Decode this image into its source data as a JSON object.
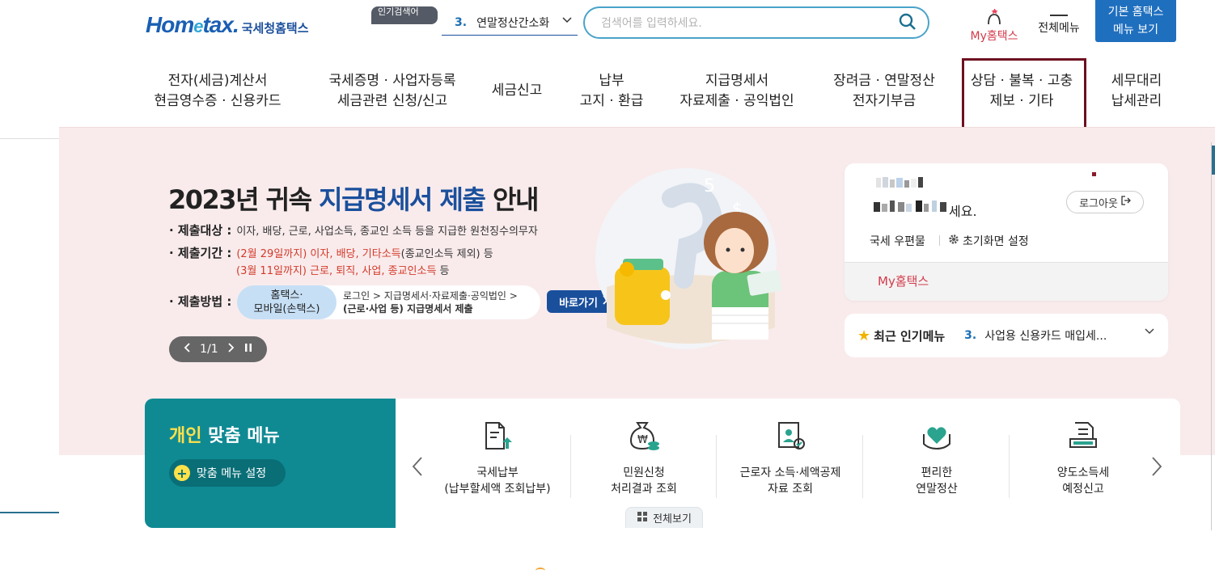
{
  "header": {
    "logo_word": "Hometax.",
    "logo_kr": "국세청홈택스",
    "logo_small": "국세청 홈택스",
    "tag_pill": "인기검색어",
    "rank_select": {
      "num": "3.",
      "value": "연말정산간소화"
    },
    "search_placeholder": "검색어를 입력하세요.",
    "my_hometax": "My홈택스",
    "full_menu": "전체메뉴",
    "basic_menu": [
      "기본 홈택스",
      "메뉴 보기"
    ]
  },
  "nav": [
    [
      "전자(세금)계산서",
      "현금영수증 · 신용카드"
    ],
    [
      "국세증명 · 사업자등록",
      "세금관련 신청/신고"
    ],
    [
      "세금신고"
    ],
    [
      "납부",
      "고지 · 환급"
    ],
    [
      "지급명세서",
      "자료제출 · 공익법인"
    ],
    [
      "장려금 · 연말정산",
      "전자기부금"
    ],
    [
      "상담 · 불복 · 고충",
      "제보 · 기타"
    ],
    [
      "세무대리",
      "납세관리"
    ]
  ],
  "banner": {
    "title_pre": "2023년 귀속 ",
    "title_hl": "지급명세서 제출",
    "title_post": " 안내",
    "target_key": "· 제출대상 :",
    "target_text": "이자, 배당, 근로, 사업소득, 종교인 소득 등을 지급한 원천징수의무자",
    "period_key": "· 제출기간 :",
    "period_line1_red": "(2월 29일까지) 이자, 배당, 기타소득",
    "period_line1_gray": "(종교인소득 제외) 등",
    "period_line2_red": "(3월 11일까지) 근로, 퇴직, 사업, 종교인소득",
    "period_line2_gray": " 등",
    "method_key": "· 제출방법 :",
    "method_chip": [
      "홈택스·",
      "모바일(손택스)"
    ],
    "method_path1": "로그인 > 지급명세서·자료제출·공익법인 >",
    "method_path2": "(근로·사업 등) 지급명세서 제출",
    "goto": "바로가기",
    "pager": "1/1"
  },
  "login": {
    "greet_tail": "세요.",
    "logout": "로그아웃",
    "post": "국세 우편물",
    "init": "초기화면 설정",
    "my": "My홈택스"
  },
  "popular": {
    "title": "최근 인기메뉴",
    "num": "3.",
    "item": "사업용 신용카드 매입세..."
  },
  "custom": {
    "title_yel": "개인",
    "title_rest": " 맞춤 메뉴",
    "setting": "맞춤 메뉴 설정",
    "view_all": "전체보기",
    "items": [
      {
        "icon": "tax-payment-icon",
        "label": [
          "국세납부",
          "(납부할세액 조회납부)"
        ]
      },
      {
        "icon": "money-bag-icon",
        "label": [
          "민원신청",
          "처리결과 조회"
        ]
      },
      {
        "icon": "worker-document-icon",
        "label": [
          "근로자 소득·세액공제",
          "자료 조회"
        ]
      },
      {
        "icon": "heart-hands-icon",
        "label": [
          "편리한",
          "연말정산"
        ]
      },
      {
        "icon": "transfer-document-icon",
        "label": [
          "양도소득세",
          "예정신고"
        ]
      }
    ]
  },
  "colors": {
    "brand_blue": "#1a4f9c",
    "accent_red": "#d33a4a",
    "teal": "#0f8a93",
    "highlight_box": "#6d1020",
    "banner_bg": "#f9ebec"
  }
}
